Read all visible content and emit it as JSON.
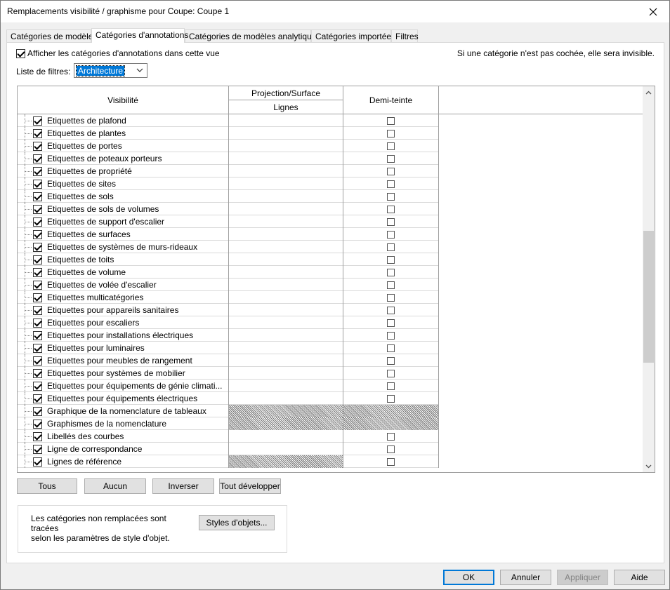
{
  "window": {
    "title": "Remplacements visibilité / graphisme pour Coupe: Coupe 1"
  },
  "tabs": [
    {
      "label": "Catégories de modèles"
    },
    {
      "label": "Catégories d'annotations"
    },
    {
      "label": "Catégories de modèles analytiques"
    },
    {
      "label": "Catégories importées"
    },
    {
      "label": "Filtres"
    }
  ],
  "active_tab": "Catégories d'annotations",
  "show_categories": {
    "label": "Afficher les catégories d'annotations dans cette vue",
    "checked": true
  },
  "hint": "Si une catégorie n'est pas cochée, elle sera invisible.",
  "filter": {
    "label": "Liste de filtres:",
    "value": "Architecture"
  },
  "grid": {
    "headers": {
      "visibility": "Visibilité",
      "projection": "Projection/Surface",
      "lines": "Lignes",
      "halftone": "Demi-teinte"
    },
    "rows": [
      {
        "label": "Etiquettes de plafond",
        "lines_hatched": false,
        "halftone": "box"
      },
      {
        "label": "Etiquettes de plantes",
        "lines_hatched": false,
        "halftone": "box"
      },
      {
        "label": "Etiquettes de portes",
        "lines_hatched": false,
        "halftone": "box"
      },
      {
        "label": "Etiquettes de poteaux porteurs",
        "lines_hatched": false,
        "halftone": "box"
      },
      {
        "label": "Etiquettes de propriété",
        "lines_hatched": false,
        "halftone": "box"
      },
      {
        "label": "Etiquettes de sites",
        "lines_hatched": false,
        "halftone": "box"
      },
      {
        "label": "Etiquettes de sols",
        "lines_hatched": false,
        "halftone": "box"
      },
      {
        "label": "Etiquettes de sols de volumes",
        "lines_hatched": false,
        "halftone": "box"
      },
      {
        "label": "Etiquettes de support d'escalier",
        "lines_hatched": false,
        "halftone": "box"
      },
      {
        "label": "Etiquettes de surfaces",
        "lines_hatched": false,
        "halftone": "box"
      },
      {
        "label": "Etiquettes de systèmes de murs-rideaux",
        "lines_hatched": false,
        "halftone": "box"
      },
      {
        "label": "Etiquettes de toits",
        "lines_hatched": false,
        "halftone": "box"
      },
      {
        "label": "Etiquettes de volume",
        "lines_hatched": false,
        "halftone": "box"
      },
      {
        "label": "Etiquettes de volée d'escalier",
        "lines_hatched": false,
        "halftone": "box"
      },
      {
        "label": "Etiquettes multicatégories",
        "lines_hatched": false,
        "halftone": "box"
      },
      {
        "label": "Etiquettes pour appareils sanitaires",
        "lines_hatched": false,
        "halftone": "box"
      },
      {
        "label": "Etiquettes pour escaliers",
        "lines_hatched": false,
        "halftone": "box"
      },
      {
        "label": "Etiquettes pour installations électriques",
        "lines_hatched": false,
        "halftone": "box"
      },
      {
        "label": "Etiquettes pour luminaires",
        "lines_hatched": false,
        "halftone": "box"
      },
      {
        "label": "Etiquettes pour meubles de rangement",
        "lines_hatched": false,
        "halftone": "box"
      },
      {
        "label": "Etiquettes pour systèmes de mobilier",
        "lines_hatched": false,
        "halftone": "box"
      },
      {
        "label": "Etiquettes pour équipements de génie climati...",
        "lines_hatched": false,
        "halftone": "box"
      },
      {
        "label": "Etiquettes pour équipements électriques",
        "lines_hatched": false,
        "halftone": "box"
      },
      {
        "label": "Graphique de la nomenclature de tableaux",
        "lines_hatched": true,
        "halftone": "hatched"
      },
      {
        "label": "Graphismes de la nomenclature",
        "lines_hatched": true,
        "halftone": "hatched"
      },
      {
        "label": "Libellés des courbes",
        "lines_hatched": false,
        "halftone": "box"
      },
      {
        "label": "Ligne de correspondance",
        "lines_hatched": false,
        "halftone": "box"
      },
      {
        "label": "Lignes de référence",
        "lines_hatched": true,
        "halftone": "box"
      }
    ]
  },
  "buttons": {
    "all": "Tous",
    "none": "Aucun",
    "invert": "Inverser",
    "expand": "Tout développer"
  },
  "info": {
    "text_line1": "Les catégories non remplacées sont tracées",
    "text_line2": "selon les paramètres de style d'objet.",
    "button": "Styles d'objets..."
  },
  "footer": {
    "ok": "OK",
    "cancel": "Annuler",
    "apply": "Appliquer",
    "help": "Aide"
  },
  "colors": {
    "accent": "#0078d7",
    "background": "#f0f0f0",
    "border": "#a0a0a0"
  }
}
